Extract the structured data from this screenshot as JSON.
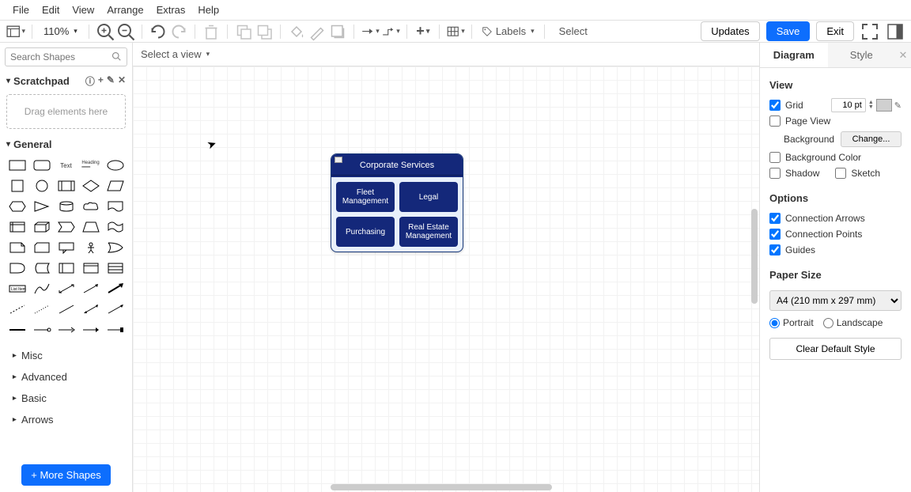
{
  "menu": {
    "file": "File",
    "edit": "Edit",
    "view": "View",
    "arrange": "Arrange",
    "extras": "Extras",
    "help": "Help"
  },
  "toolbar": {
    "zoom": "110%",
    "labels": "Labels",
    "select": "Select",
    "updates": "Updates",
    "save": "Save",
    "exit": "Exit"
  },
  "sidebar": {
    "search_placeholder": "Search Shapes",
    "scratchpad_label": "Scratchpad",
    "scratchpad_hint": "Drag elements here",
    "general_label": "General",
    "collapsed_sections": [
      "Misc",
      "Advanced",
      "Basic",
      "Arrows"
    ],
    "more_shapes": "More Shapes"
  },
  "view_select": "Select a view",
  "diagram": {
    "title": "Corporate Services",
    "children": [
      "Fleet Management",
      "Legal",
      "Purchasing",
      "Real Estate Management"
    ]
  },
  "right": {
    "tab_diagram": "Diagram",
    "tab_style": "Style",
    "view_title": "View",
    "grid_label": "Grid",
    "grid_value": "10 pt",
    "page_view": "Page View",
    "background": "Background",
    "change": "Change...",
    "background_color": "Background Color",
    "shadow": "Shadow",
    "sketch": "Sketch",
    "options_title": "Options",
    "conn_arrows": "Connection Arrows",
    "conn_points": "Connection Points",
    "guides": "Guides",
    "paper_size_title": "Paper Size",
    "paper_size_value": "A4 (210 mm x 297 mm)",
    "portrait": "Portrait",
    "landscape": "Landscape",
    "clear_default": "Clear Default Style"
  }
}
